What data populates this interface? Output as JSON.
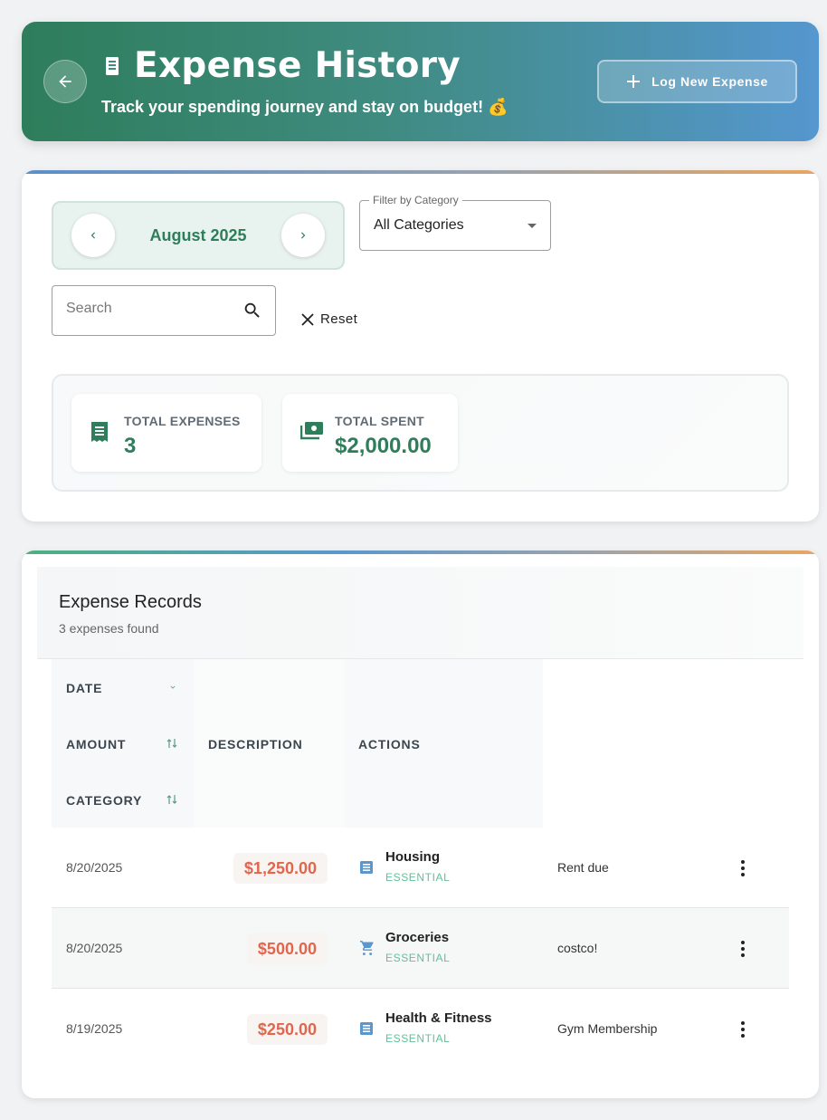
{
  "header": {
    "title": "Expense History",
    "subtitle": "Track your spending journey and stay on budget! 💰",
    "log_button": "Log New Expense"
  },
  "filters": {
    "month": "August 2025",
    "category_label": "Filter by Category",
    "category_value": "All Categories",
    "search_placeholder": "Search",
    "reset_label": "Reset"
  },
  "stats": {
    "total_expenses_label": "TOTAL EXPENSES",
    "total_expenses_value": "3",
    "total_spent_label": "TOTAL SPENT",
    "total_spent_value": "$2,000.00"
  },
  "records": {
    "title": "Expense Records",
    "subtitle": "3 expenses found",
    "columns": {
      "date": "DATE",
      "amount": "AMOUNT",
      "category": "CATEGORY",
      "description": "DESCRIPTION",
      "actions": "ACTIONS"
    },
    "rows": [
      {
        "date": "8/20/2025",
        "amount": "$1,250.00",
        "category": "Housing",
        "tag": "ESSENTIAL",
        "description": "Rent due",
        "icon": "receipt-icon"
      },
      {
        "date": "8/20/2025",
        "amount": "$500.00",
        "category": "Groceries",
        "tag": "ESSENTIAL",
        "description": "costco!",
        "icon": "cart-icon"
      },
      {
        "date": "8/19/2025",
        "amount": "$250.00",
        "category": "Health & Fitness",
        "tag": "ESSENTIAL",
        "description": "Gym Membership",
        "icon": "receipt-icon"
      }
    ]
  },
  "colors": {
    "brand_green": "#2e7d5b",
    "header_blue": "#5597cf",
    "amount_red": "#e0664d",
    "tag_green": "#5fc19a",
    "icon_blue": "#5b97cc"
  }
}
